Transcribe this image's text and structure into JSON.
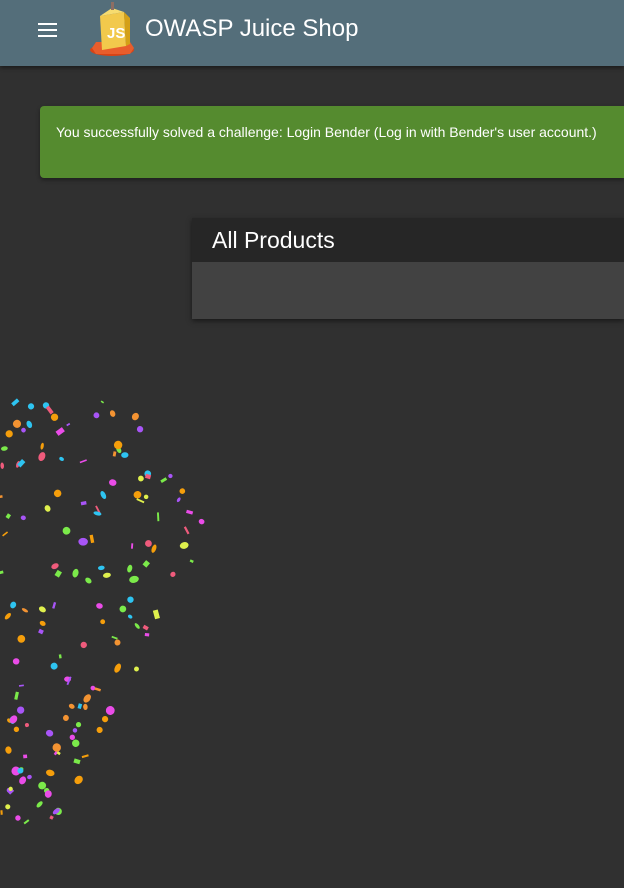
{
  "header": {
    "title": "OWASP Juice Shop",
    "logo_text": "JS",
    "menu_icon": "menu-icon",
    "background": "#546e7a"
  },
  "notification": {
    "message": "You successfully solved a challenge: Login Bender (Log in with Bender's user account.)",
    "background": "#558b2f"
  },
  "products": {
    "title": "All Products"
  },
  "theme": {
    "page_background": "#303030",
    "card_header": "#262626",
    "card_body": "#424242"
  },
  "confetti_colors": [
    "#ea4ce8",
    "#a855f7",
    "#2ec4f1",
    "#f59e0b",
    "#ef5b7c",
    "#dff04d",
    "#7bea4a",
    "#f39332"
  ]
}
